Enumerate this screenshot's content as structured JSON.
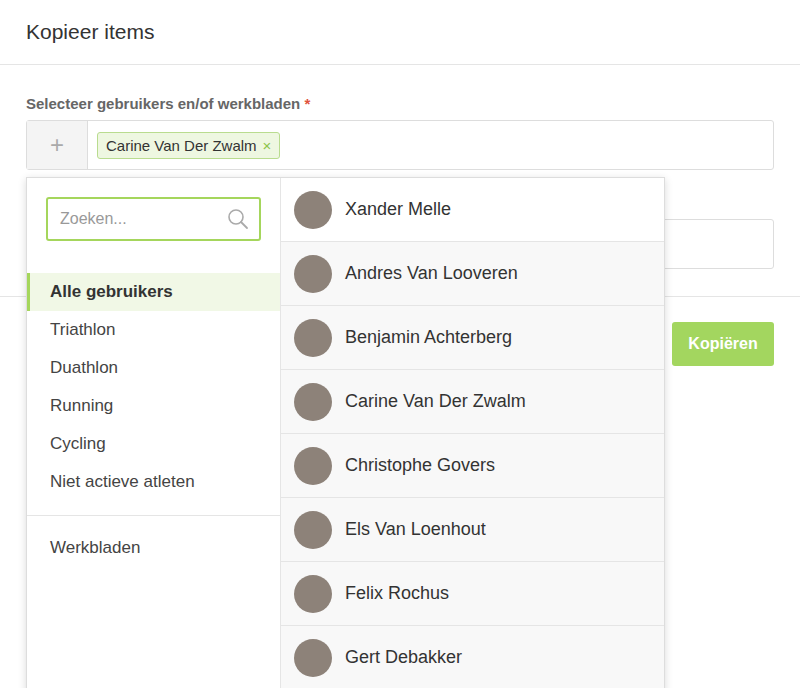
{
  "window": {
    "title": "Kopieer items"
  },
  "field": {
    "label": "Selecteer gebruikers en/of werkbladen",
    "required_mark": "*",
    "add_icon": "+",
    "tags": [
      {
        "label": "Carine Van Der Zwalm",
        "remove": "×"
      }
    ]
  },
  "dropdown": {
    "search": {
      "placeholder": "Zoeken..."
    },
    "groups": [
      {
        "label": "Alle gebruikers",
        "selected": true
      },
      {
        "label": "Triathlon",
        "selected": false
      },
      {
        "label": "Duathlon",
        "selected": false
      },
      {
        "label": "Running",
        "selected": false
      },
      {
        "label": "Cycling",
        "selected": false
      },
      {
        "label": "Niet actieve atleten",
        "selected": false
      }
    ],
    "worksheets": {
      "label": "Werkbladen",
      "selected": false
    },
    "users": [
      {
        "name": "Xander Melle"
      },
      {
        "name": "Andres Van Looveren"
      },
      {
        "name": "Benjamin Achterberg"
      },
      {
        "name": "Carine Van Der Zwalm"
      },
      {
        "name": "Christophe Govers"
      },
      {
        "name": "Els Van Loenhout"
      },
      {
        "name": "Felix Rochus"
      },
      {
        "name": "Gert Debakker"
      }
    ]
  },
  "buttons": [
    "Kopiëren"
  ]
}
